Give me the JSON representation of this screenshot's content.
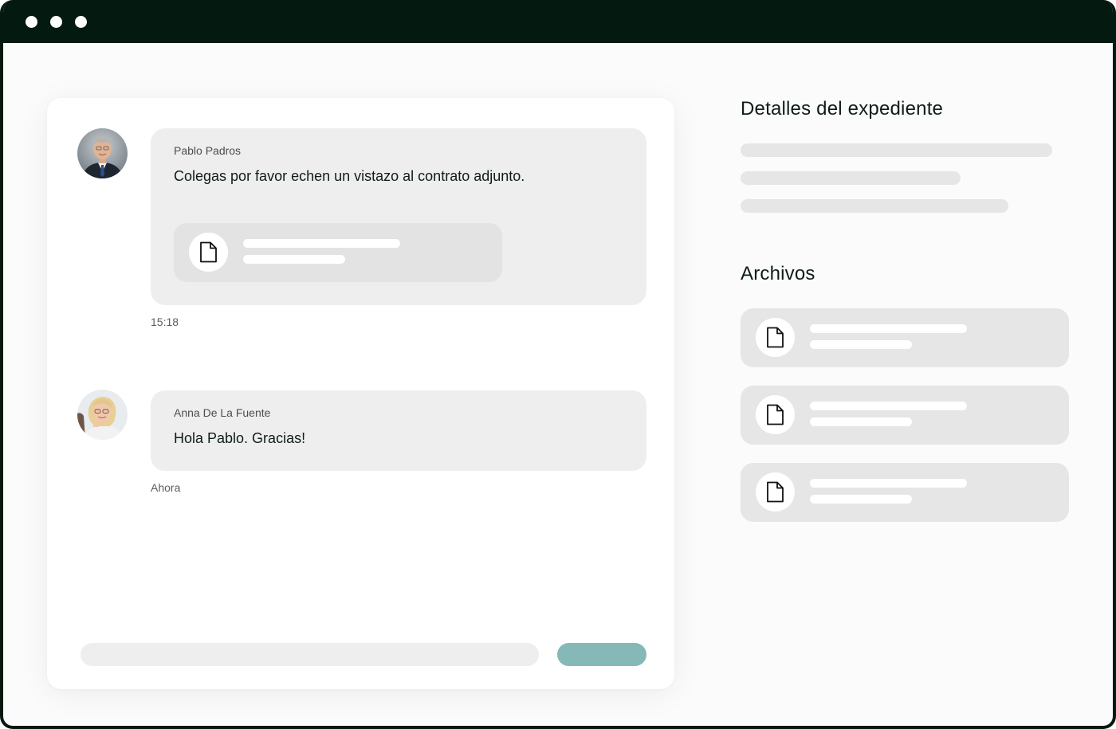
{
  "window": {
    "controls": [
      "window-dot",
      "window-dot",
      "window-dot"
    ]
  },
  "chat": {
    "messages": [
      {
        "sender": "Pablo Padros",
        "text": "Colegas por favor echen un vistazo al contrato adjunto.",
        "time": "15:18",
        "has_attachment": true,
        "attachment_icon": "document-icon"
      },
      {
        "sender": "Anna De La Fuente",
        "text": "Hola Pablo. Gracias!",
        "time": "Ahora",
        "has_attachment": false
      }
    ],
    "send_button_color": "#86b8b8"
  },
  "panel": {
    "details_title": "Detalles del expediente",
    "files_title": "Archivos",
    "files": [
      {
        "icon": "document-icon"
      },
      {
        "icon": "document-icon"
      },
      {
        "icon": "document-icon"
      }
    ]
  },
  "colors": {
    "frame": "#041a10",
    "bubble": "#eeeeee",
    "skeleton": "#e6e6e6",
    "accent": "#86b8b8"
  }
}
